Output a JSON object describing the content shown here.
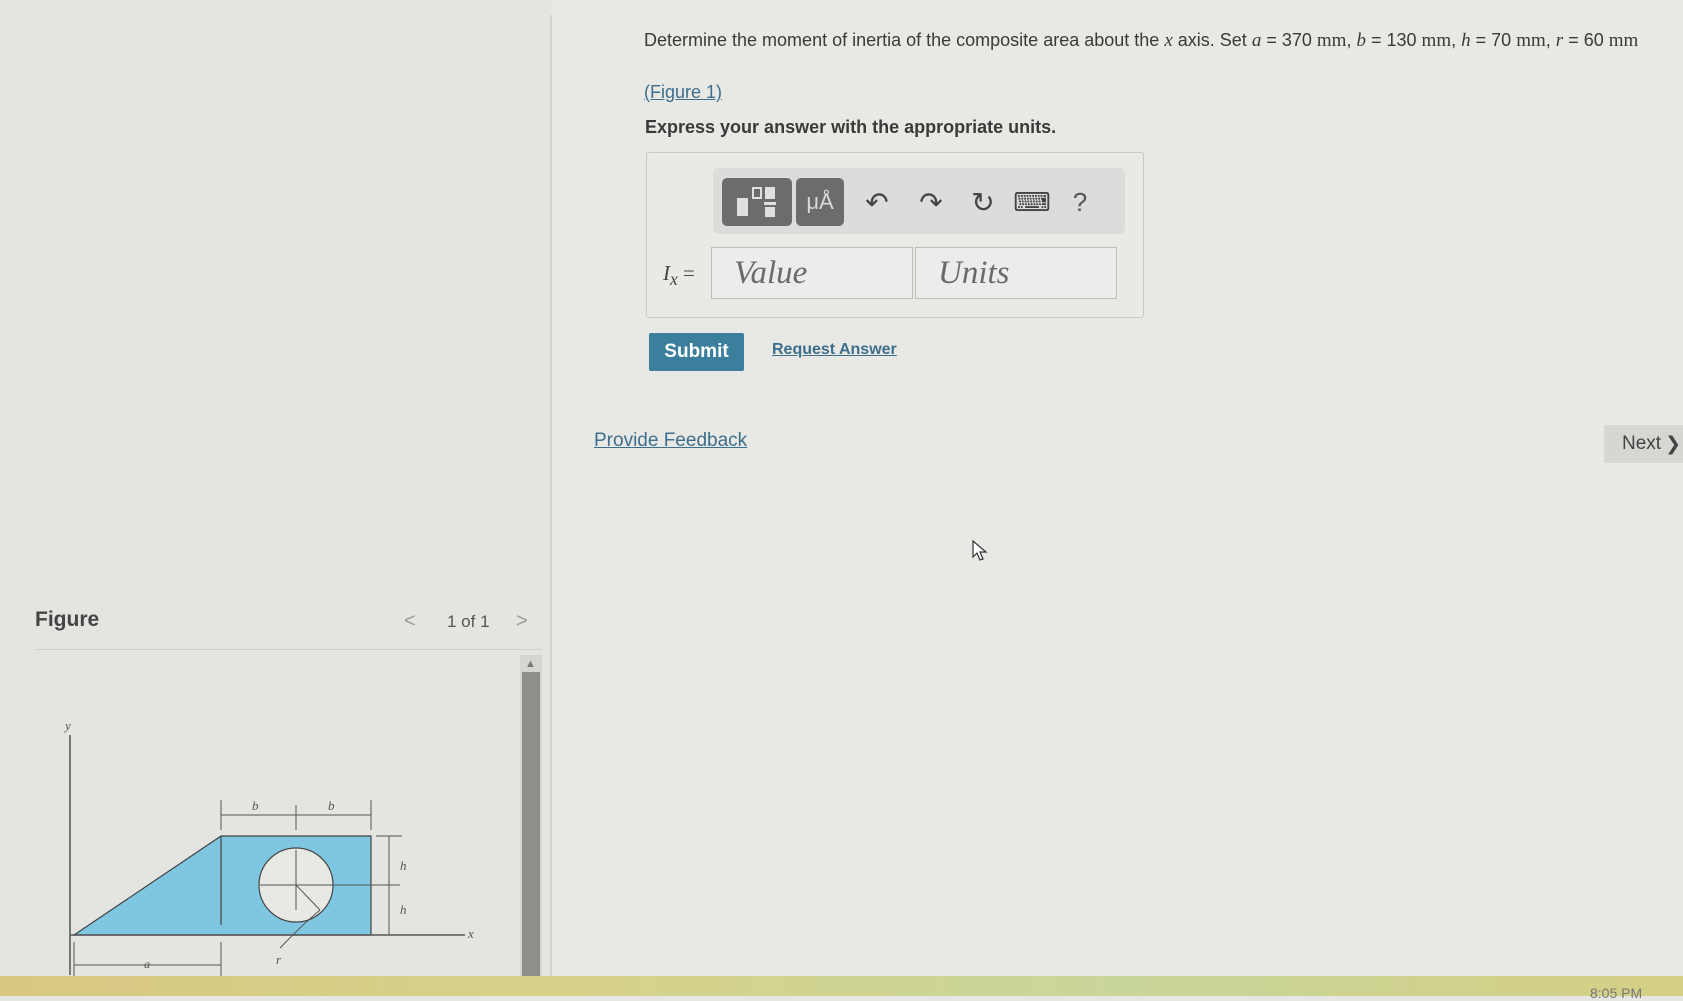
{
  "question": {
    "prefix": "Determine the moment of inertia of the composite area about the",
    "axis_var": "x",
    "axis_word": "axis. Set",
    "a_var": "a",
    "a_val": "= 370",
    "b_var": "b",
    "b_val": "= 130",
    "h_var": "h",
    "h_val": "= 70",
    "r_var": "r",
    "r_val": "= 60",
    "unit": "mm",
    "figure_link": "(Figure 1)",
    "instructions": "Express your answer with the appropriate units."
  },
  "toolbar": {
    "mu_label": "μÅ",
    "undo_icon": "↶",
    "redo_icon": "↷",
    "reset_icon": "↻",
    "keyboard_icon": "⌨",
    "help_label": "?"
  },
  "answer": {
    "var_symbol": "I",
    "var_sub": "x",
    "equals": "=",
    "value_placeholder": "Value",
    "units_placeholder": "Units"
  },
  "actions": {
    "submit": "Submit",
    "request_answer": "Request Answer",
    "provide_feedback": "Provide Feedback",
    "next": "Next",
    "next_icon": "❯"
  },
  "figure": {
    "title": "Figure",
    "page": "1 of 1",
    "prev_icon": "<",
    "next_icon": ">",
    "labels": {
      "y": "y",
      "x": "x",
      "a": "a",
      "b1": "b",
      "b2": "b",
      "h1": "h",
      "h2": "h",
      "r": "r"
    },
    "fill_color": "#7fc6e0"
  },
  "taskbar": {
    "clock": "8:05 PM"
  }
}
